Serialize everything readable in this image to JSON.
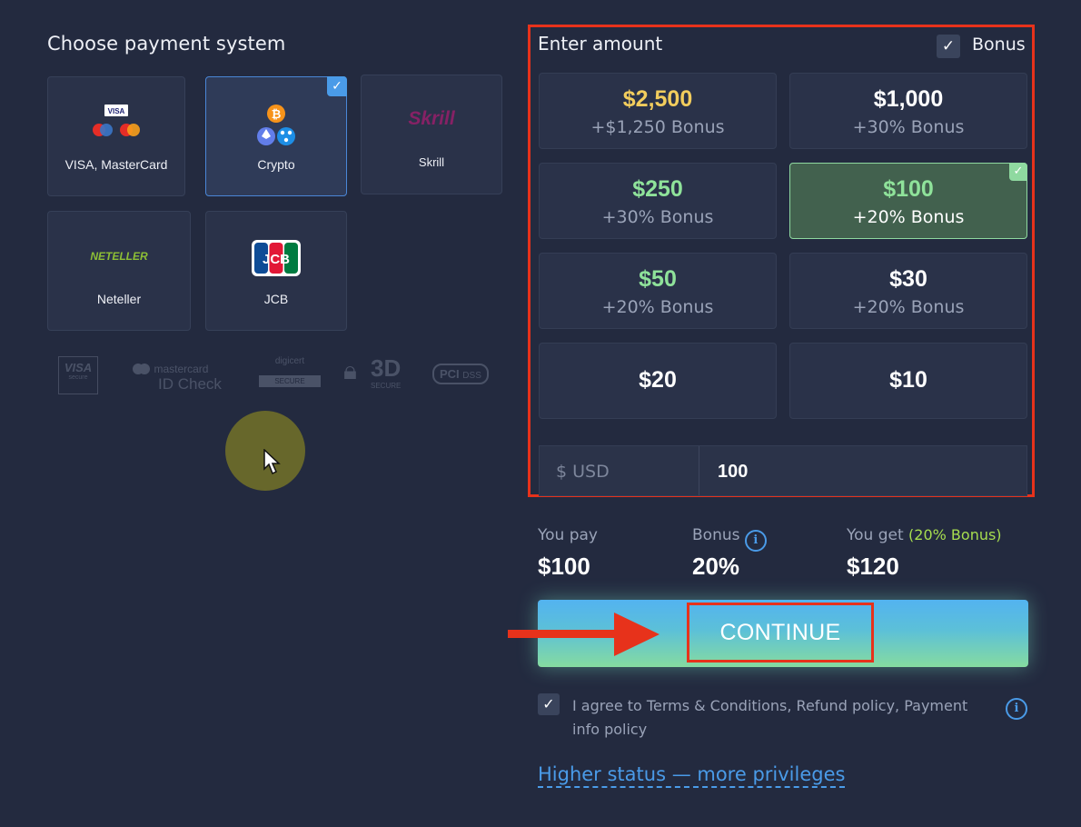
{
  "payment": {
    "title": "Choose payment system",
    "methods": [
      {
        "label": "VISA, MasterCard",
        "icon": "visa-mastercard-icon",
        "selected": false
      },
      {
        "label": "Crypto",
        "icon": "crypto-icon",
        "selected": true
      },
      {
        "label": "Skrill",
        "icon": "skrill-icon",
        "selected": false
      },
      {
        "label": "Neteller",
        "icon": "neteller-icon",
        "selected": false
      },
      {
        "label": "JCB",
        "icon": "jcb-icon",
        "selected": false
      }
    ],
    "logo_text": {
      "visa": "VISA",
      "skrill": "Skrill",
      "neteller": "NETELLER",
      "jcb": "JCB"
    },
    "trust_badges": {
      "visa": "VISA",
      "visa_sub": "secure",
      "mastercard": "mastercard",
      "mastercard_sub": "ID Check",
      "digicert": "digicert",
      "digicert_sub": "SECURE",
      "three_d": "3D",
      "three_d_sub": "SECURE",
      "pci": "PCI",
      "pci_sub": "DSS"
    }
  },
  "amount": {
    "title": "Enter amount",
    "bonus_label": "Bonus",
    "bonus_checked": true,
    "options": [
      {
        "value": "$2,500",
        "bonus": "+$1,250 Bonus",
        "style": "gold"
      },
      {
        "value": "$1,000",
        "bonus": "+30% Bonus",
        "style": "white"
      },
      {
        "value": "$250",
        "bonus": "+30% Bonus",
        "style": "green"
      },
      {
        "value": "$100",
        "bonus": "+20% Bonus",
        "style": "active"
      },
      {
        "value": "$50",
        "bonus": "+20% Bonus",
        "style": "green"
      },
      {
        "value": "$30",
        "bonus": "+20% Bonus",
        "style": "white"
      },
      {
        "value": "$20",
        "bonus": "",
        "style": "white"
      },
      {
        "value": "$10",
        "bonus": "",
        "style": "white"
      }
    ],
    "currency_prefix": "$ USD",
    "input_value": "100"
  },
  "summary": {
    "you_pay_label": "You pay",
    "you_pay_value": "$100",
    "bonus_label": "Bonus",
    "bonus_value": "20%",
    "you_get_label": "You get",
    "you_get_note": "(20% Bonus)",
    "you_get_value": "$120"
  },
  "continue_label": "CONTINUE",
  "agree": {
    "checked": true,
    "text": "I agree to Terms & Conditions, Refund policy, Payment info policy"
  },
  "higher_status_link": "Higher status — more privileges",
  "colors": {
    "background": "#232a3f",
    "accent_blue": "#4a9be8",
    "highlight_red": "#e7321b",
    "bonus_green": "#8fe29a",
    "gold": "#f2cd5d"
  }
}
